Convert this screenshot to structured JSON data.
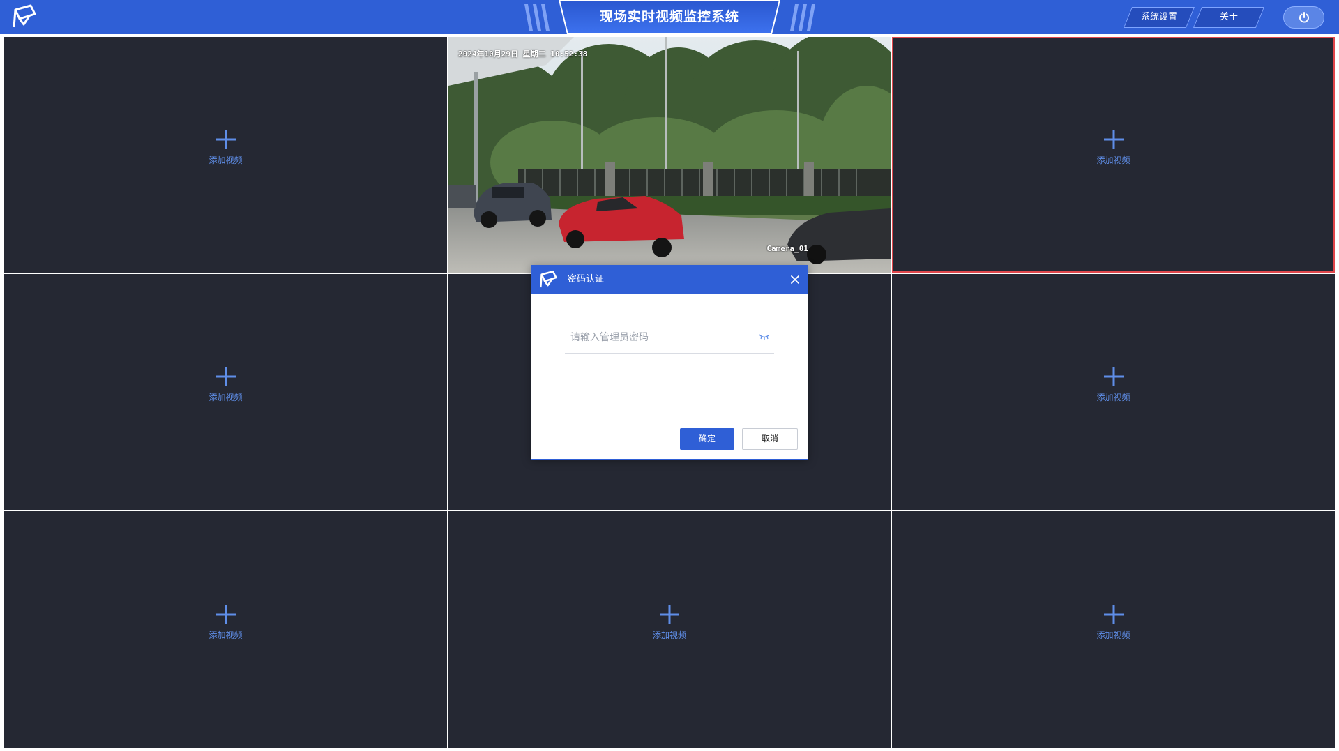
{
  "app": {
    "title": "现场实时视频监控系统",
    "nav": {
      "settings": "系统设置",
      "about": "关于"
    }
  },
  "grid": {
    "add_label": "添加视频",
    "cells": [
      {
        "type": "empty",
        "label": "添加视频"
      },
      {
        "type": "live",
        "osd_time": "2024年10月29日 星期二 10:52:38",
        "osd_camera": "Camera_01"
      },
      {
        "type": "empty",
        "label": "添加视频",
        "selected": true
      },
      {
        "type": "empty",
        "label": "添加视频"
      },
      {
        "type": "empty",
        "label": ""
      },
      {
        "type": "empty",
        "label": "添加视频"
      },
      {
        "type": "empty",
        "label": "添加视频"
      },
      {
        "type": "empty",
        "label": "添加视频"
      },
      {
        "type": "empty",
        "label": "添加视频"
      }
    ]
  },
  "dialog": {
    "title": "密码认证",
    "password_placeholder": "请输入管理员密码",
    "confirm_label": "确定",
    "cancel_label": "取消"
  },
  "icons": {
    "logo": "camera-logo-icon",
    "power": "power-icon",
    "add": "plus-icon",
    "close": "close-icon",
    "eye": "eye-closed-icon"
  },
  "colors": {
    "primary": "#2f5fd6",
    "cell_bg": "#252833",
    "add_icon": "#5f8ee8",
    "selected_border": "#e0474c"
  }
}
